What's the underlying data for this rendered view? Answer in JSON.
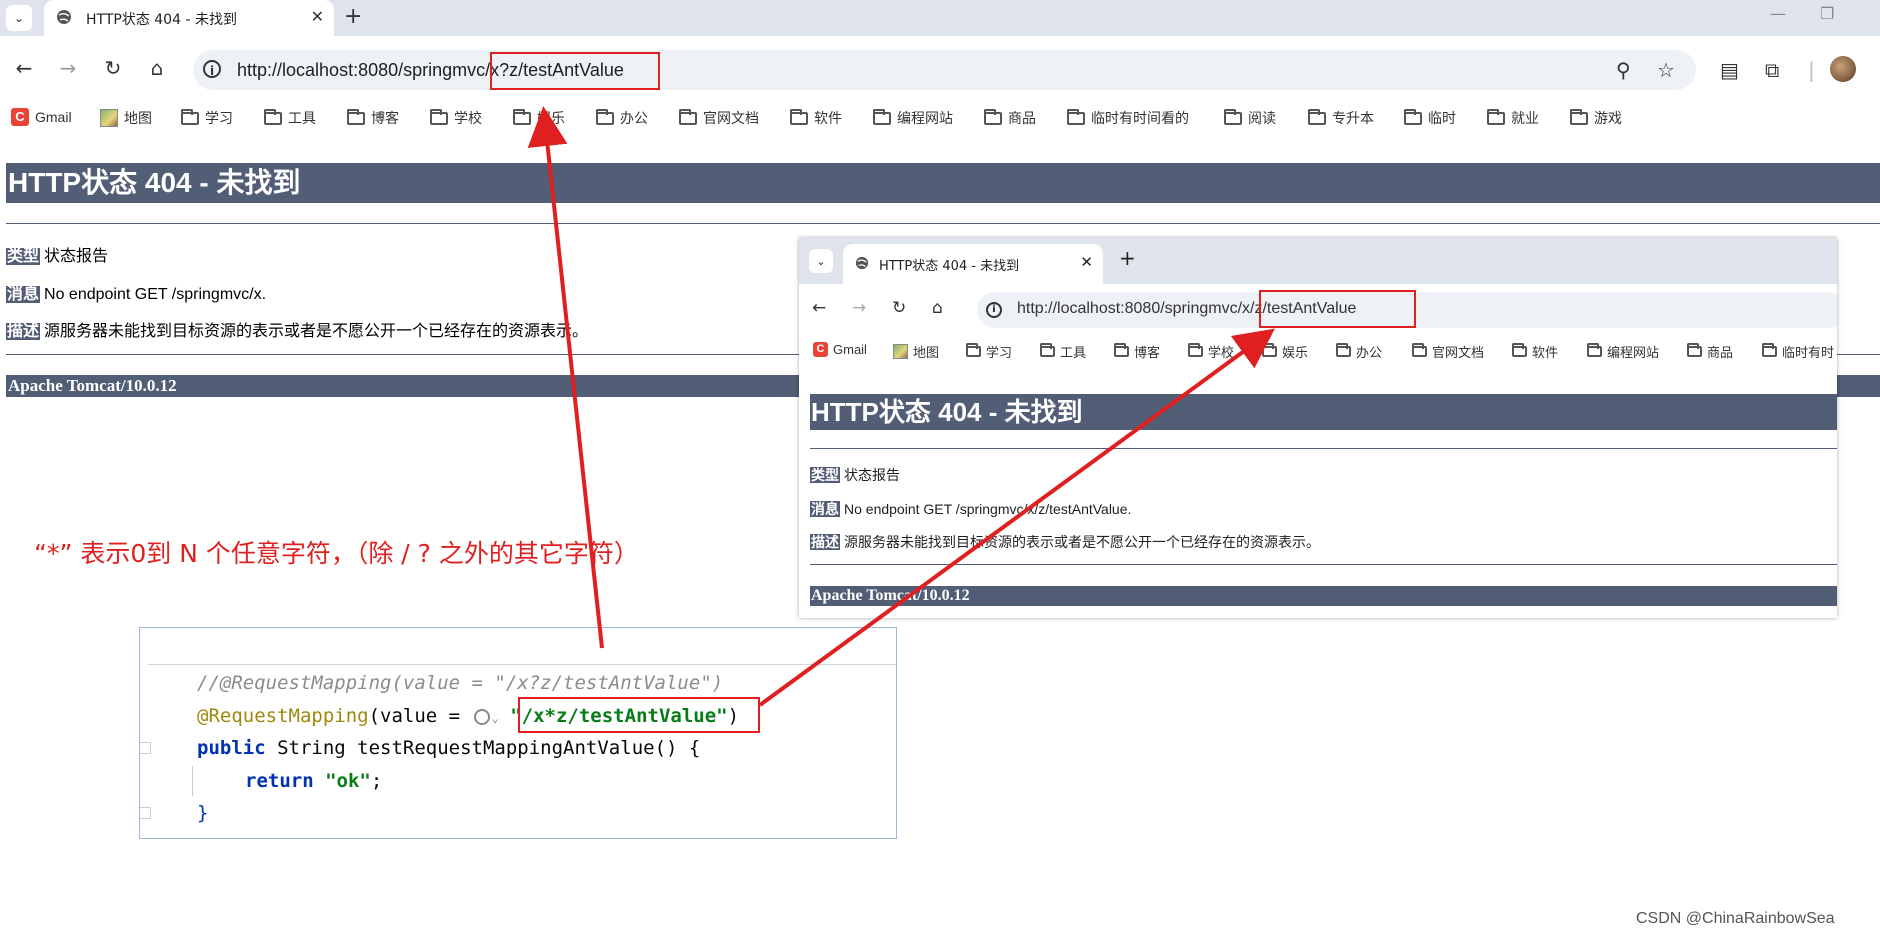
{
  "browser": {
    "tab_title": "HTTP状态 404 - 未找到",
    "url": "http://localhost:8080/springmvc/x?z/testAntValue",
    "url_prefix": "http://localhost:8080/springmv",
    "url_boxed": "c/x?z/testAntValue",
    "bookmarks": [
      "Gmail",
      "地图",
      "学习",
      "工具",
      "博客",
      "学校",
      "娱乐",
      "办公",
      "官网文档",
      "软件",
      "编程网站",
      "商品",
      "临时有时间看的",
      "阅读",
      "专升本",
      "临时",
      "就业",
      "游戏"
    ]
  },
  "page": {
    "heading": "HTTP状态 404 - 未找到",
    "type_label": "类型",
    "type_value": "状态报告",
    "message_label": "消息",
    "message_value": "No endpoint GET /springmvc/x.",
    "desc_label": "描述",
    "desc_value": "源服务器未能找到目标资源的表示或者是不愿公开一个已经存在的资源表示。",
    "footer": "Apache Tomcat/10.0.12"
  },
  "annotation": "“*” 表示0到 N 个任意字符，（除 / ? 之外的其它字符）",
  "inset": {
    "tab_title": "HTTP状态 404 - 未找到",
    "url_prefix": "http://localhost:8080/springmvc",
    "url_boxed": "/x/z/testAntValue",
    "bookmarks": [
      "Gmail",
      "地图",
      "学习",
      "工具",
      "博客",
      "学校",
      "娱乐",
      "办公",
      "官网文档",
      "软件",
      "编程网站",
      "商品",
      "临时有时"
    ],
    "heading": "HTTP状态 404 - 未找到",
    "type_label": "类型",
    "type_value": "状态报告",
    "message_label": "消息",
    "message_value": "No endpoint GET /springmvc/x/z/testAntValue.",
    "desc_label": "描述",
    "desc_value": "源服务器未能找到目标资源的表示或者是不愿公开一个已经存在的资源表示。",
    "footer": "Apache Tomcat/10.0.12"
  },
  "code": {
    "line1": "//@RequestMapping(value = \"/x?z/testAntValue\")",
    "line2_anno": "@RequestMapping",
    "line2_open": "(value = ",
    "line2_string": "\"/x*z/testAntValue\"",
    "line2_close": ")",
    "line3_kw": "public",
    "line3_rest": " String testRequestMappingAntValue() {",
    "line4_kw": "return",
    "line4_string": "\"ok\"",
    "line4_end": ";",
    "line5": "}"
  },
  "watermark": "CSDN @ChinaRainbowSea",
  "colors": {
    "tomcat_bar": "#525d76",
    "annotation_red": "#e02020"
  }
}
